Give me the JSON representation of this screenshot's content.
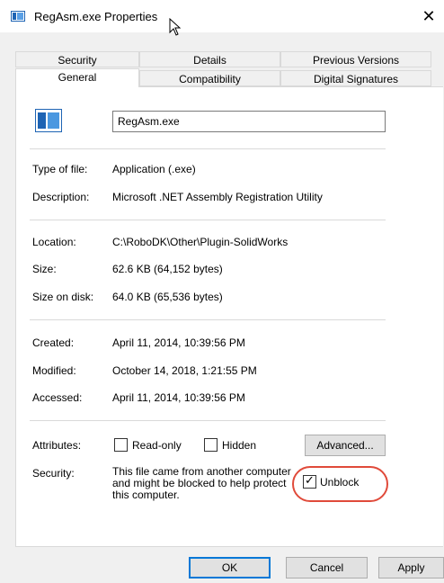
{
  "window": {
    "title": "RegAsm.exe Properties",
    "close_glyph": "✕"
  },
  "tabs_row1": [
    "Security",
    "Details",
    "Previous Versions"
  ],
  "tabs_row2": [
    "General",
    "Compatibility",
    "Digital Signatures"
  ],
  "file": {
    "name": "RegAsm.exe"
  },
  "info": {
    "type_label": "Type of file:",
    "type_value": "Application (.exe)",
    "desc_label": "Description:",
    "desc_value": "Microsoft .NET Assembly Registration Utility",
    "location_label": "Location:",
    "location_value": "C:\\RoboDK\\Other\\Plugin-SolidWorks",
    "size_label": "Size:",
    "size_value": "62.6 KB (64,152 bytes)",
    "size_disk_label": "Size on disk:",
    "size_disk_value": "64.0 KB (65,536 bytes)",
    "created_label": "Created:",
    "created_value": "April 11, 2014, 10:39:56 PM",
    "modified_label": "Modified:",
    "modified_value": "October 14, 2018, 1:21:55 PM",
    "accessed_label": "Accessed:",
    "accessed_value": "April 11, 2014, 10:39:56 PM"
  },
  "attributes": {
    "label": "Attributes:",
    "readonly_label": "Read-only",
    "readonly_checked": false,
    "hidden_label": "Hidden",
    "hidden_checked": false,
    "advanced_label": "Advanced..."
  },
  "security": {
    "label": "Security:",
    "message": "This file came from another computer and might be blocked to help protect this computer.",
    "unblock_label": "Unblock",
    "unblock_checked": true
  },
  "buttons": {
    "ok": "OK",
    "cancel": "Cancel",
    "apply": "Apply"
  },
  "colors": {
    "accent": "#0078d7",
    "highlight": "#e04a3a",
    "icon_blue": "#1e64b4"
  }
}
